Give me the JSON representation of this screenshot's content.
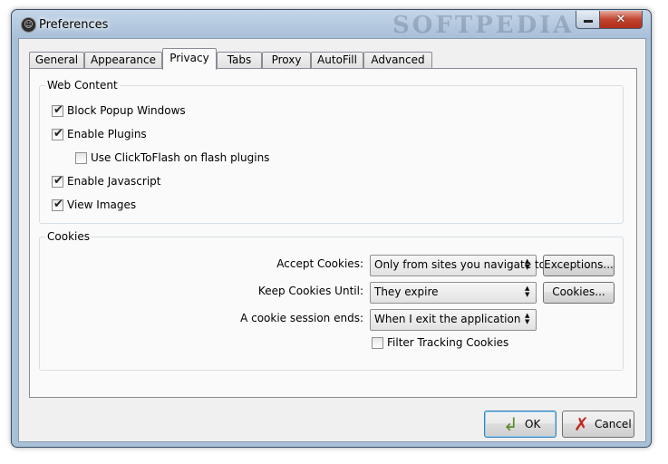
{
  "window": {
    "title": "Preferences",
    "watermark": "SOFTPEDIA",
    "close_glyph": "✕"
  },
  "tabs": [
    {
      "label": "General"
    },
    {
      "label": "Appearance"
    },
    {
      "label": "Privacy"
    },
    {
      "label": "Tabs"
    },
    {
      "label": "Proxy"
    },
    {
      "label": "AutoFill"
    },
    {
      "label": "Advanced"
    }
  ],
  "web_content": {
    "title": "Web Content",
    "block_popups": {
      "label": "Block Popup Windows",
      "checked": true
    },
    "enable_plugins": {
      "label": "Enable Plugins",
      "checked": true
    },
    "click_to_flash": {
      "label": "Use ClickToFlash on flash plugins",
      "checked": false
    },
    "enable_javascript": {
      "label": "Enable Javascript",
      "checked": true
    },
    "view_images": {
      "label": "View Images",
      "checked": true
    }
  },
  "cookies": {
    "title": "Cookies",
    "accept_label": "Accept Cookies:",
    "accept_value": "Only from sites you navigate to",
    "exceptions_button": "Exceptions...",
    "keep_label": "Keep Cookies Until:",
    "keep_value": "They expire",
    "cookies_button": "Cookies...",
    "session_label": "A cookie session ends:",
    "session_value": "When I exit the application",
    "filter_tracking": {
      "label": "Filter Tracking Cookies",
      "checked": false
    }
  },
  "dialog_buttons": {
    "ok": "OK",
    "cancel": "Cancel"
  },
  "glyphs": {
    "check": "✔",
    "combo_arrows": "▲▼"
  },
  "colors": {
    "title_bar": "#a9c0d9",
    "close_button": "#c2432f",
    "dialog_bg": "#f0f0f0",
    "pane_bg": "#fafafa",
    "ok_icon": "#5a8a2a",
    "cancel_icon": "#c0281e"
  }
}
